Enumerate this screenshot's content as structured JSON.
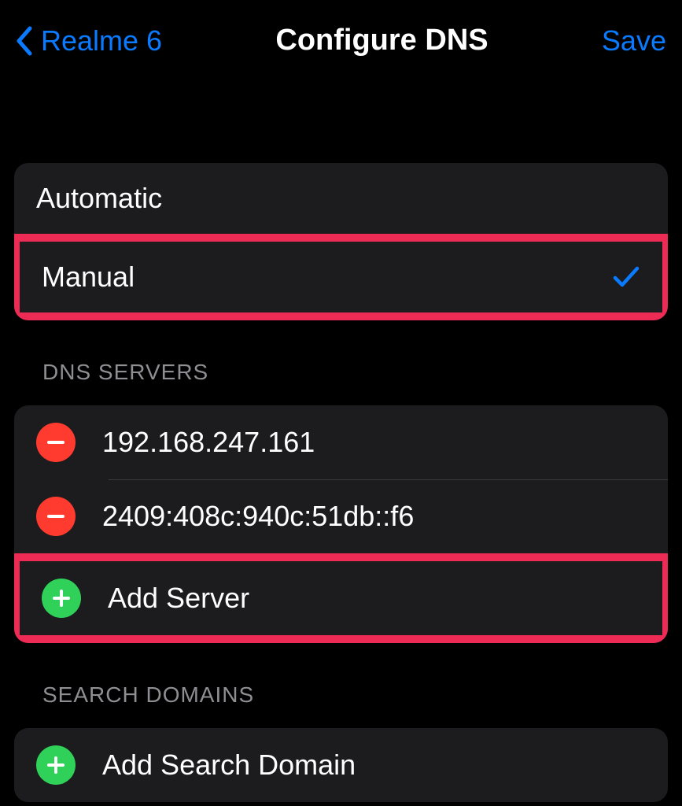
{
  "header": {
    "back_label": "Realme 6",
    "title": "Configure DNS",
    "save_label": "Save"
  },
  "mode": {
    "automatic_label": "Automatic",
    "manual_label": "Manual"
  },
  "dns_servers": {
    "section_title": "DNS SERVERS",
    "items": [
      {
        "value": "192.168.247.161"
      },
      {
        "value": "2409:408c:940c:51db::f6"
      }
    ],
    "add_label": "Add Server"
  },
  "search_domains": {
    "section_title": "SEARCH DOMAINS",
    "add_label": "Add Search Domain"
  }
}
